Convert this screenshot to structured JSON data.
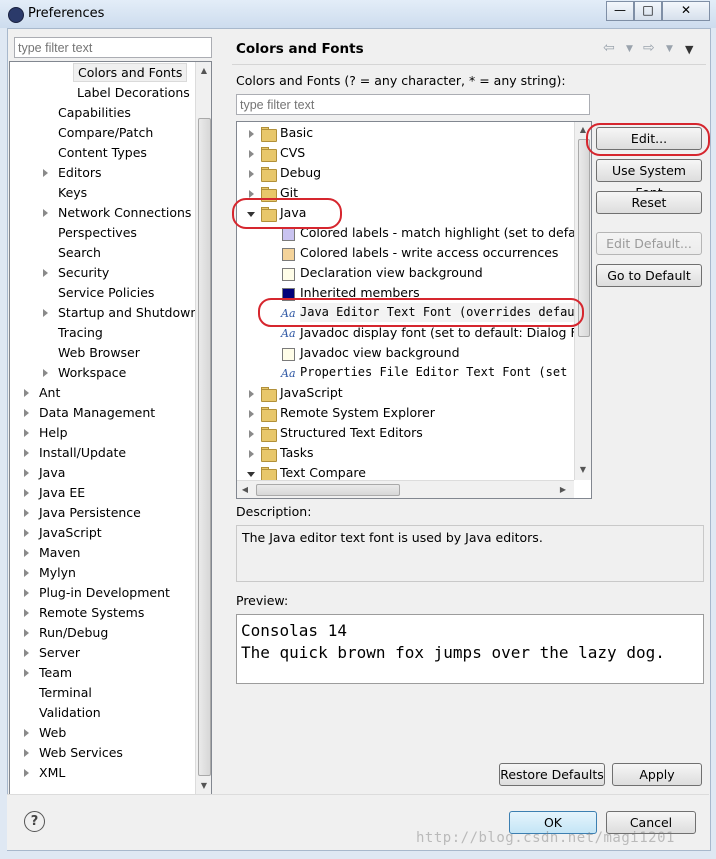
{
  "window": {
    "title": "Preferences",
    "controls": [
      "—",
      "□",
      "✕"
    ]
  },
  "left": {
    "filter_placeholder": "type filter text",
    "tree": [
      {
        "label": "Colors and Fonts",
        "level": 2,
        "twisty": "none",
        "selected": true
      },
      {
        "label": "Label Decorations",
        "level": 2,
        "twisty": "none"
      },
      {
        "label": "Capabilities",
        "level": 1,
        "twisty": "none"
      },
      {
        "label": "Compare/Patch",
        "level": 1,
        "twisty": "none"
      },
      {
        "label": "Content Types",
        "level": 1,
        "twisty": "none"
      },
      {
        "label": "Editors",
        "level": 1,
        "twisty": "closed"
      },
      {
        "label": "Keys",
        "level": 1,
        "twisty": "none"
      },
      {
        "label": "Network Connections",
        "level": 1,
        "twisty": "closed"
      },
      {
        "label": "Perspectives",
        "level": 1,
        "twisty": "none"
      },
      {
        "label": "Search",
        "level": 1,
        "twisty": "none"
      },
      {
        "label": "Security",
        "level": 1,
        "twisty": "closed"
      },
      {
        "label": "Service Policies",
        "level": 1,
        "twisty": "none"
      },
      {
        "label": "Startup and Shutdown",
        "level": 1,
        "twisty": "closed"
      },
      {
        "label": "Tracing",
        "level": 1,
        "twisty": "none"
      },
      {
        "label": "Web Browser",
        "level": 1,
        "twisty": "none"
      },
      {
        "label": "Workspace",
        "level": 1,
        "twisty": "closed"
      },
      {
        "label": "Ant",
        "level": 0,
        "twisty": "closed"
      },
      {
        "label": "Data Management",
        "level": 0,
        "twisty": "closed"
      },
      {
        "label": "Help",
        "level": 0,
        "twisty": "closed"
      },
      {
        "label": "Install/Update",
        "level": 0,
        "twisty": "closed"
      },
      {
        "label": "Java",
        "level": 0,
        "twisty": "closed"
      },
      {
        "label": "Java EE",
        "level": 0,
        "twisty": "closed"
      },
      {
        "label": "Java Persistence",
        "level": 0,
        "twisty": "closed"
      },
      {
        "label": "JavaScript",
        "level": 0,
        "twisty": "closed"
      },
      {
        "label": "Maven",
        "level": 0,
        "twisty": "closed"
      },
      {
        "label": "Mylyn",
        "level": 0,
        "twisty": "closed"
      },
      {
        "label": "Plug-in Development",
        "level": 0,
        "twisty": "closed"
      },
      {
        "label": "Remote Systems",
        "level": 0,
        "twisty": "closed"
      },
      {
        "label": "Run/Debug",
        "level": 0,
        "twisty": "closed"
      },
      {
        "label": "Server",
        "level": 0,
        "twisty": "closed"
      },
      {
        "label": "Team",
        "level": 0,
        "twisty": "closed"
      },
      {
        "label": "Terminal",
        "level": 0,
        "twisty": "none"
      },
      {
        "label": "Validation",
        "level": 0,
        "twisty": "none"
      },
      {
        "label": "Web",
        "level": 0,
        "twisty": "closed"
      },
      {
        "label": "Web Services",
        "level": 0,
        "twisty": "closed"
      },
      {
        "label": "XML",
        "level": 0,
        "twisty": "closed"
      }
    ]
  },
  "panel": {
    "title": "Colors and Fonts",
    "nav_icons": [
      "back-arrow-icon",
      "dropdown-icon",
      "forward-arrow-icon",
      "dropdown-icon",
      "menu-icon"
    ],
    "hint": "Colors and Fonts (? = any character, * = any string):",
    "filter_placeholder": "type filter text",
    "tree": [
      {
        "label": "Basic",
        "kind": "folder",
        "twisty": "closed"
      },
      {
        "label": "CVS",
        "kind": "folder",
        "twisty": "closed"
      },
      {
        "label": "Debug",
        "kind": "folder",
        "twisty": "closed"
      },
      {
        "label": "Git",
        "kind": "folder",
        "twisty": "closed"
      },
      {
        "label": "Java",
        "kind": "folder",
        "twisty": "open"
      },
      {
        "label": "Colored labels - match highlight (set to default",
        "kind": "color",
        "color": "#c9c3f0"
      },
      {
        "label": "Colored labels - write access occurrences",
        "kind": "color",
        "color": "#f4d39a"
      },
      {
        "label": "Declaration view background",
        "kind": "color",
        "color": "#fffde8"
      },
      {
        "label": "Inherited members",
        "kind": "color",
        "color": "#00007a"
      },
      {
        "label": "Java Editor Text Font (overrides default",
        "kind": "font",
        "mono": true,
        "selected": true
      },
      {
        "label": "Javadoc display font (set to default: Dialog Fon",
        "kind": "font"
      },
      {
        "label": "Javadoc view background",
        "kind": "color",
        "color": "#fffde8"
      },
      {
        "label": "Properties File Editor Text Font (set t",
        "kind": "font",
        "mono": true
      },
      {
        "label": "JavaScript",
        "kind": "folder",
        "twisty": "closed"
      },
      {
        "label": "Remote System Explorer",
        "kind": "folder",
        "twisty": "closed"
      },
      {
        "label": "Structured Text Editors",
        "kind": "folder",
        "twisty": "closed"
      },
      {
        "label": "Tasks",
        "kind": "folder",
        "twisty": "closed"
      },
      {
        "label": "Text Compare",
        "kind": "folder",
        "twisty": "open"
      }
    ],
    "buttons": {
      "edit": "Edit...",
      "use_system_font": "Use System Font",
      "reset": "Reset",
      "edit_default": "Edit Default...",
      "go_to_default": "Go to Default"
    },
    "description_label": "Description:",
    "description_text": "The Java editor text font is used by Java editors.",
    "preview_label": "Preview:",
    "preview_lines": [
      "Consolas 14",
      "The quick brown fox jumps over the lazy dog."
    ],
    "restore_defaults": "Restore Defaults",
    "apply": "Apply"
  },
  "footer": {
    "help_symbol": "?",
    "ok": "OK",
    "cancel": "Cancel",
    "watermark": "http://blog.csdn.net/magi1201"
  }
}
